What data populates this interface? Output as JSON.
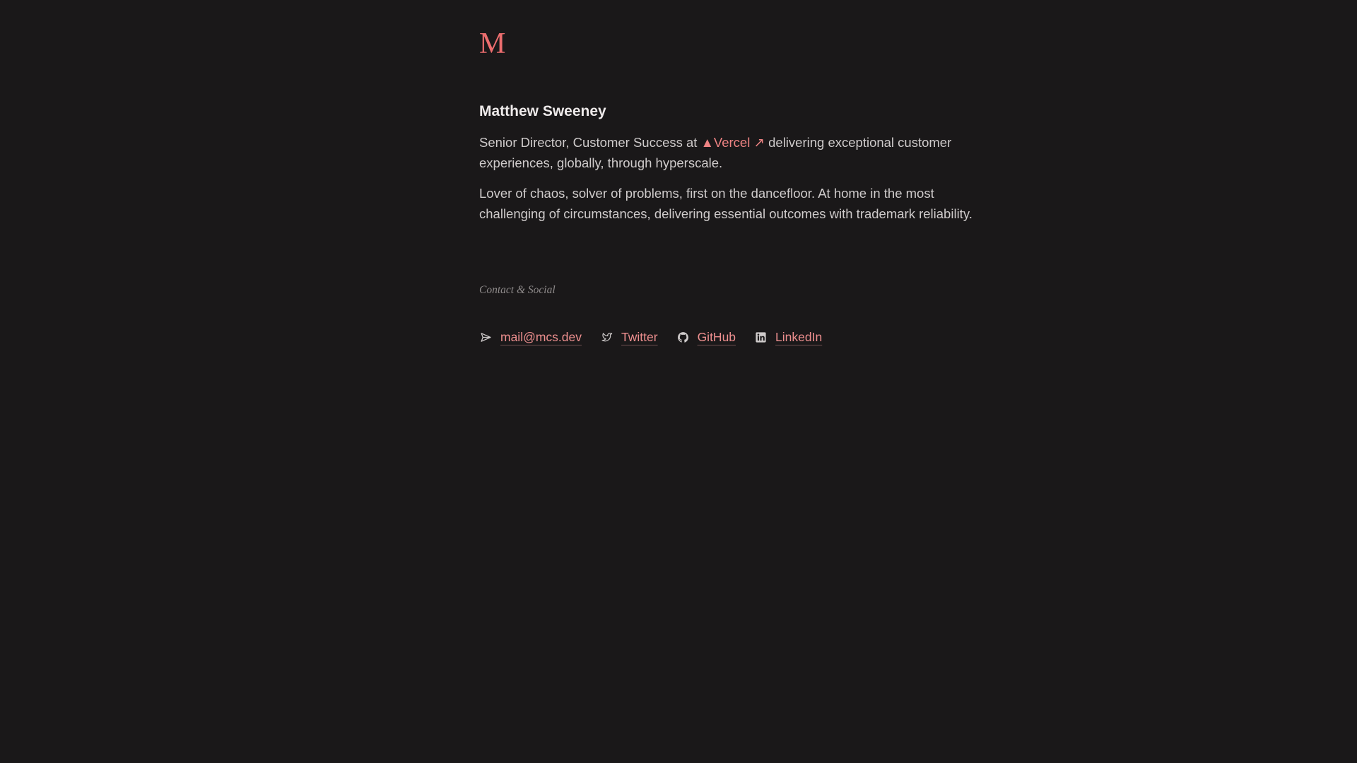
{
  "header": {
    "logo_text": "M"
  },
  "profile": {
    "name": "Matthew Sweeney",
    "bio_line1_prefix": "Senior Director, Customer Success at ",
    "company_logo": "▲",
    "company_name": "Vercel",
    "company_link_arrow": "↗",
    "bio_line1_suffix": " delivering exceptional customer experiences, globally, through hyperscale.",
    "bio_line2": "Lover of chaos, solver of problems, first on the dancefloor. At home in the most challenging of circumstances, delivering essential outcomes with trademark reliability."
  },
  "contact": {
    "section_label": "Contact & Social",
    "items": [
      {
        "label": "mail@mcs.dev",
        "icon": "send-icon"
      },
      {
        "label": "Twitter",
        "icon": "twitter-icon"
      },
      {
        "label": "GitHub",
        "icon": "github-icon"
      },
      {
        "label": "LinkedIn",
        "icon": "linkedin-icon"
      }
    ]
  },
  "colors": {
    "background": "#1a1819",
    "accent": "#ec6d6e",
    "text": "#cfcbcb",
    "muted": "#8e8a8a"
  }
}
